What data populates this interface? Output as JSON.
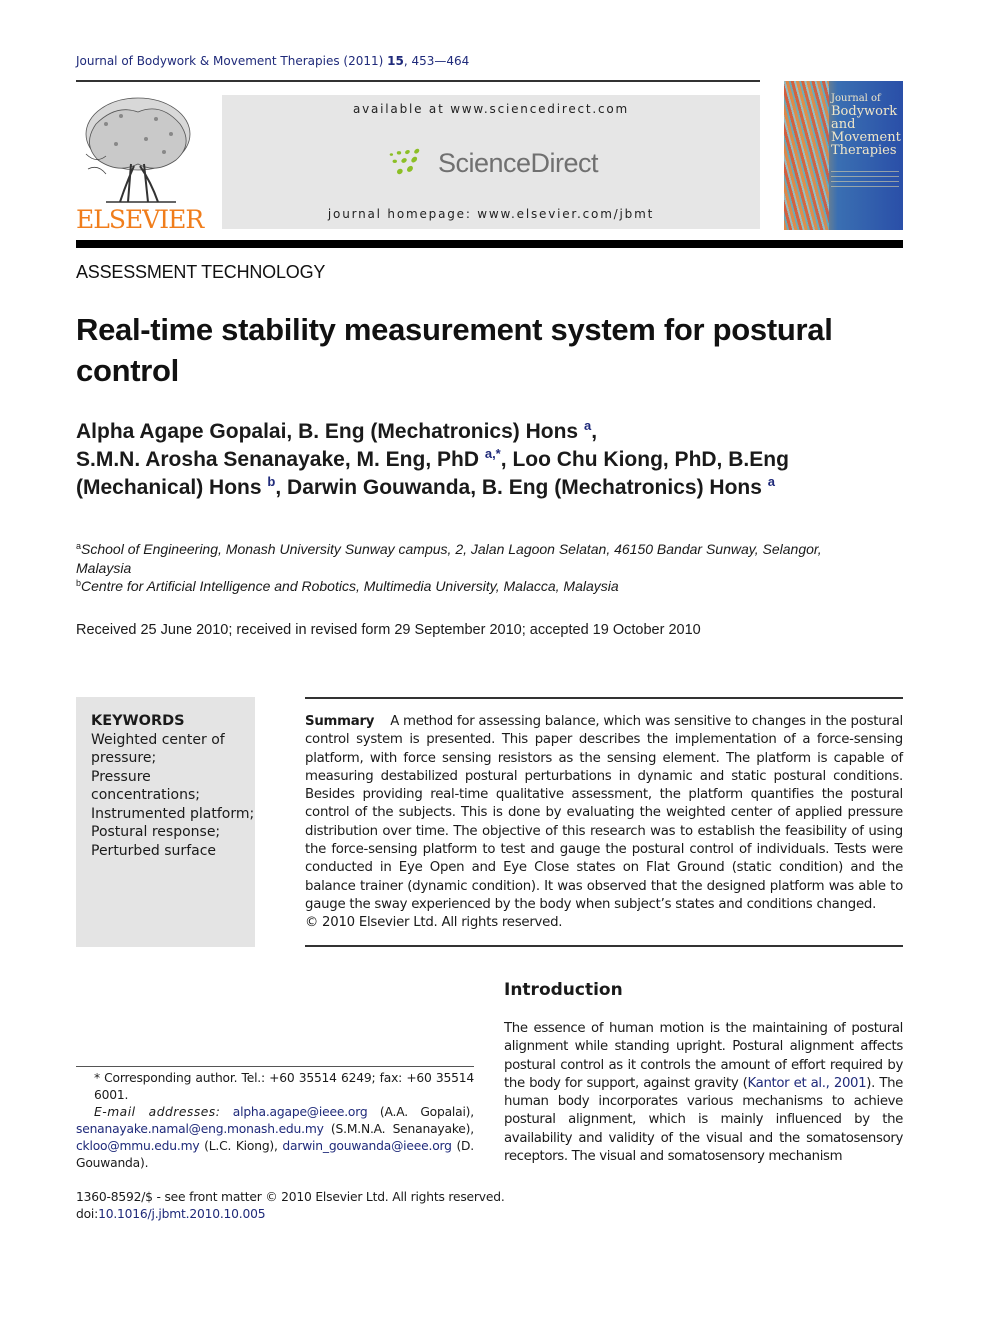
{
  "header": {
    "journal_name": "Journal of Bodywork & Movement Therapies",
    "year": "(2011)",
    "volume": "15",
    "pages": "453—464",
    "publisher_logo_text": "ELSEVIER",
    "available_at": "available at www.sciencedirect.com",
    "sciencedirect_logo_text": "ScienceDirect",
    "journal_homepage": "journal homepage: www.elsevier.com/jbmt",
    "cover": {
      "title_line1": "Journal of",
      "title_line2": "Bodywork",
      "title_line3": "and",
      "title_line4": "Movement",
      "title_line5": "Therapies"
    }
  },
  "article": {
    "section": "ASSESSMENT TECHNOLOGY",
    "title": "Real-time stability measurement system for postural control",
    "authors": [
      {
        "name": "Alpha Agape Gopalai, B. Eng (Mechatronics) Hons",
        "sup": "a",
        "sep": ","
      },
      {
        "name": "S.M.N. Arosha Senanayake, M. Eng, PhD",
        "sup": "a,*",
        "sep": ","
      },
      {
        "name": "Loo Chu Kiong, PhD, B.Eng (Mechanical) Hons",
        "sup": "b",
        "sep": ","
      },
      {
        "name": "Darwin Gouwanda, B. Eng (Mechatronics) Hons",
        "sup": "a",
        "sep": ""
      }
    ],
    "affiliations": [
      {
        "key": "a",
        "text": "School of Engineering, Monash University Sunway campus, 2, Jalan Lagoon Selatan, 46150 Bandar Sunway, Selangor, Malaysia"
      },
      {
        "key": "b",
        "text": "Centre for Artificial Intelligence and Robotics, Multimedia University, Malacca, Malaysia"
      }
    ],
    "received": "Received 25 June 2010; received in revised form 29 September 2010; accepted 19 October 2010",
    "keywords": {
      "title": "KEYWORDS",
      "items": [
        "Weighted center of pressure;",
        "Pressure concentrations;",
        "Instrumented platform;",
        "Postural response;",
        "Perturbed surface"
      ]
    },
    "summary": {
      "label": "Summary",
      "text": "A method for assessing balance, which was sensitive to changes in the postural control system is presented. This paper describes the implementation of a force-sensing platform, with force sensing resistors as the sensing element. The platform is capable of measuring destabilized postural perturbations in dynamic and static postural conditions. Besides providing real-time qualitative assessment, the platform quantifies the postural control of the subjects. This is done by evaluating the weighted center of applied pressure distribution over time. The objective of this research was to establish the feasibility of using the force-sensing platform to test and gauge the postural control of individuals. Tests were conducted in Eye Open and Eye Close states on Flat Ground (static condition) and the balance trainer (dynamic condition). It was observed that the designed platform was able to gauge the sway experienced by the body when subject’s states and conditions changed.",
      "copyright": "© 2010 Elsevier Ltd. All rights reserved."
    },
    "introduction": {
      "heading": "Introduction",
      "text_before_citation": "The essence of human motion is the maintaining of postural alignment while standing upright. Postural alignment affects postural control as it controls the amount of effort required by the body for support, against gravity (",
      "citation": "Kantor et al., 2001",
      "text_after_citation": "). The human body incorporates various mechanisms to achieve postural alignment, which is mainly influenced by the availability and validity of the visual and the somatosensory receptors. The visual and somatosensory mechanism"
    }
  },
  "footnotes": {
    "corresponding": "* Corresponding author. Tel.: +60 35514 6249; fax: +60 35514 6001.",
    "email_label": "E-mail addresses:",
    "emails": [
      {
        "address": "alpha.agape@ieee.org",
        "owner": "(A.A. Gopalai),"
      },
      {
        "address": "senanayake.namal@eng.monash.edu.my",
        "owner": "(S.M.N.A. Senanayake),"
      },
      {
        "address": "ckloo@mmu.edu.my",
        "owner": "(L.C. Kiong),"
      },
      {
        "address": "darwin_gouwanda@ieee.org",
        "owner": "(D. Gouwanda)."
      }
    ],
    "front_matter": "1360-8592/$ - see front matter © 2010 Elsevier Ltd. All rights reserved.",
    "doi_label": "doi:",
    "doi": "10.1016/j.jbmt.2010.10.005"
  },
  "colors": {
    "link": "#1f2a7a",
    "elsevier_orange": "#f07d1b",
    "sciencedirect_green": "#8cbf26"
  }
}
